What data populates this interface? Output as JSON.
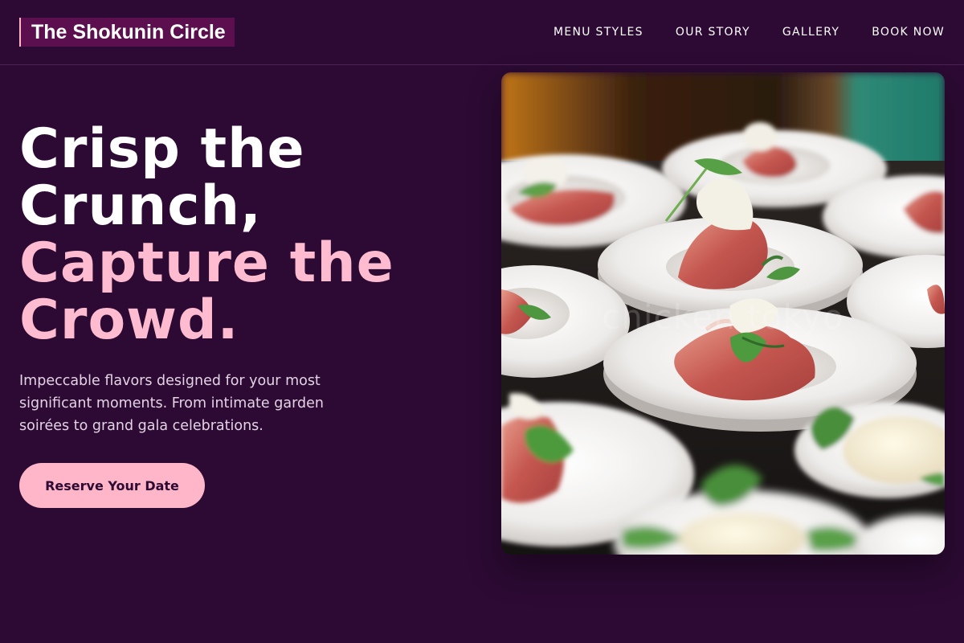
{
  "header": {
    "brand": "The Shokunin Circle",
    "nav": [
      "MENU STYLES",
      "OUR STORY",
      "GALLERY",
      "BOOK NOW"
    ]
  },
  "hero": {
    "title_lines": [
      "Crisp the",
      "Crunch,"
    ],
    "accent_lines": [
      "Capture the",
      "Crowd."
    ],
    "subtitle": "Impeccable flavors designed for your most significant moments. From intimate garden soirées to grand gala celebrations.",
    "cta_label": "Reserve Your Date"
  },
  "photo": {
    "watermark": "chicken tokyo"
  },
  "colors": {
    "background": "#2c0a33",
    "accent": "#ffb6c8",
    "brand_bg": "#5c0f4e"
  }
}
